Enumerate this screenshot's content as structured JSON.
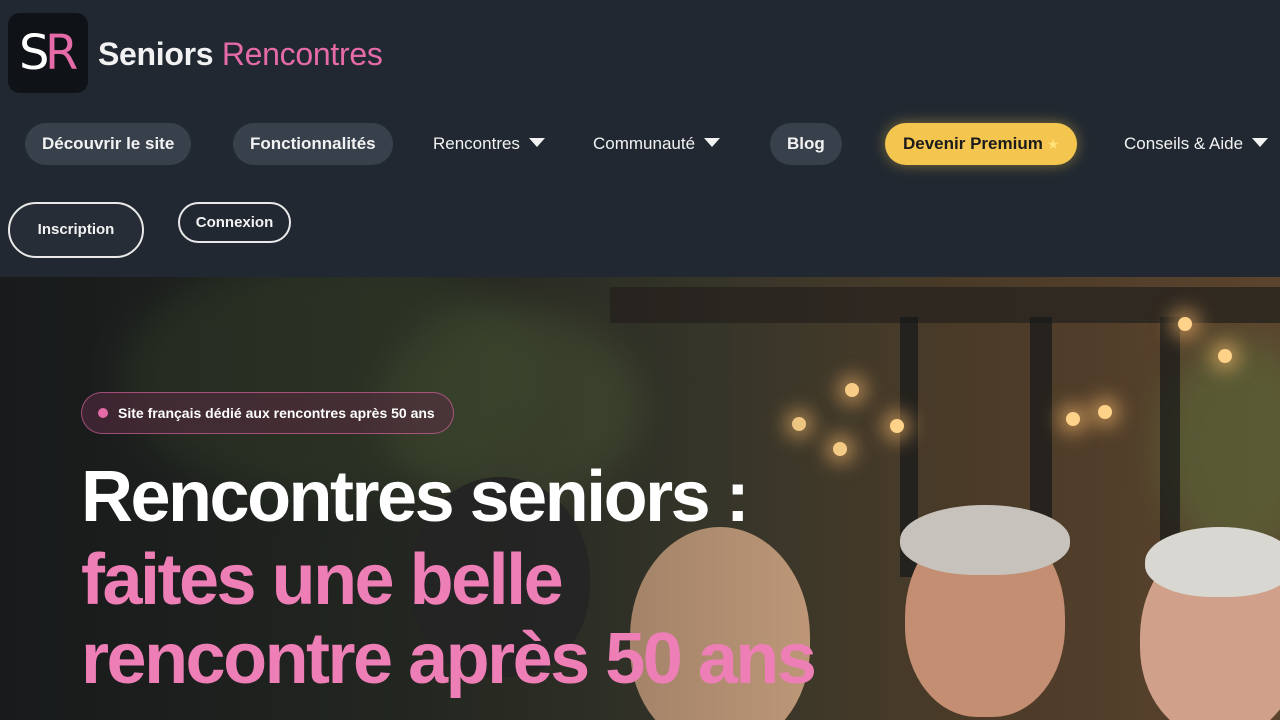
{
  "brand": {
    "logo_s": "S",
    "logo_r": "R",
    "name_part1": "Seniors",
    "name_part2": "Rencontres",
    "accent_color": "#e46aa8"
  },
  "nav": {
    "discover": "Découvrir le site",
    "features": "Fonctionnalités",
    "meetings": "Rencontres",
    "community": "Communauté",
    "blog": "Blog",
    "premium": "Devenir Premium",
    "premium_icon": "star-icon",
    "help": "Conseils & Aide"
  },
  "auth": {
    "signup": "Inscription",
    "login": "Connexion"
  },
  "hero": {
    "badge": "Site français dédié aux rencontres après 50 ans",
    "title_line1": "Rencontres seniors :",
    "title_line2": "faites une belle",
    "title_line3": "rencontre après 50 ans"
  }
}
